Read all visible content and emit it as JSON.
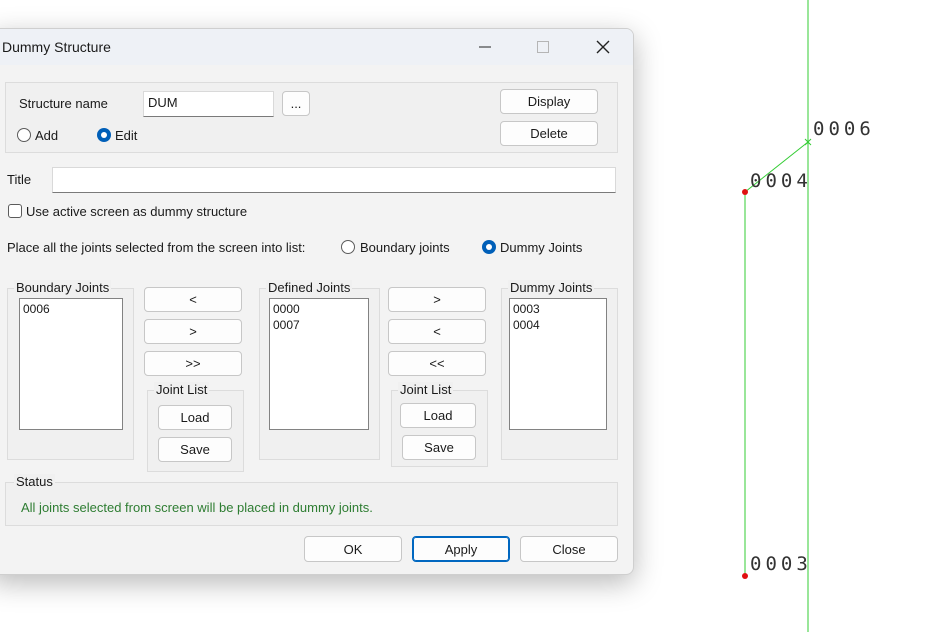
{
  "window": {
    "title": "Dummy Structure"
  },
  "structure": {
    "name_label": "Structure name",
    "name_value": "DUM",
    "browse_label": "...",
    "display_label": "Display",
    "delete_label": "Delete",
    "mode_add_label": "Add",
    "mode_edit_label": "Edit",
    "mode_selected": "Edit"
  },
  "title_field": {
    "label": "Title",
    "value": ""
  },
  "use_active_screen": {
    "label": "Use active screen as dummy structure",
    "checked": false
  },
  "place": {
    "label": "Place all the joints selected from the screen into list:",
    "option_boundary": "Boundary joints",
    "option_dummy": "Dummy Joints",
    "selected": "Dummy Joints"
  },
  "lists": {
    "boundary": {
      "title": "Boundary Joints",
      "items": [
        "0006"
      ]
    },
    "defined": {
      "title": "Defined Joints",
      "items": [
        "0000",
        "0007"
      ]
    },
    "dummy": {
      "title": "Dummy Joints",
      "items": [
        "0003",
        "0004"
      ]
    }
  },
  "left_transfer": {
    "move_left": "<",
    "move_right": ">",
    "move_all_right": ">>"
  },
  "right_transfer": {
    "move_right": ">",
    "move_left": "<",
    "move_all_left": "<<"
  },
  "joint_list_left": {
    "title": "Joint List",
    "load": "Load",
    "save": "Save"
  },
  "joint_list_right": {
    "title": "Joint List",
    "load": "Load",
    "save": "Save"
  },
  "status": {
    "title": "Status",
    "message": "All joints selected from screen will be placed in dummy joints."
  },
  "footer": {
    "ok": "OK",
    "apply": "Apply",
    "close": "Close"
  },
  "canvas": {
    "joint_labels": [
      "0006",
      "0004",
      "0003"
    ],
    "line_color": "#33cc33",
    "joint_color": "#e01010"
  },
  "colors": {
    "accent": "#005fb8",
    "status_text": "#2e7d32"
  }
}
